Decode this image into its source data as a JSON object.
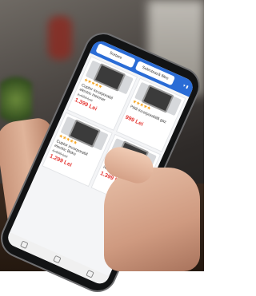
{
  "app": {
    "tab_left": "Sortare",
    "tab_right": "Selectează filtre",
    "status_icons": "▾ ▮"
  },
  "products": [
    {
      "icon": "oven-icon",
      "stars": "★★★★★",
      "title": "Cuptor incorporabil electric Heinner",
      "old_price": "1.499 Lei",
      "price": "1.399 Lei"
    },
    {
      "icon": "oven-icon",
      "stars": "★★★★★",
      "title": "Plită incorporabilă gaz",
      "old_price": "",
      "price": "999 Lei"
    },
    {
      "icon": "oven-icon",
      "stars": "★★★★★",
      "title": "Cuptor incorporabil electric Beko",
      "old_price": "1.499 Lei",
      "price": "1.299 Lei"
    },
    {
      "icon": "hob-icon",
      "stars": "★★★★★",
      "title": "Plită incorporabilă gaz Heinner",
      "old_price": "",
      "price": "1.399 Lei"
    }
  ],
  "colors": {
    "brand": "#2a6cd6",
    "price": "#e53935",
    "stars": "#f5a623"
  }
}
